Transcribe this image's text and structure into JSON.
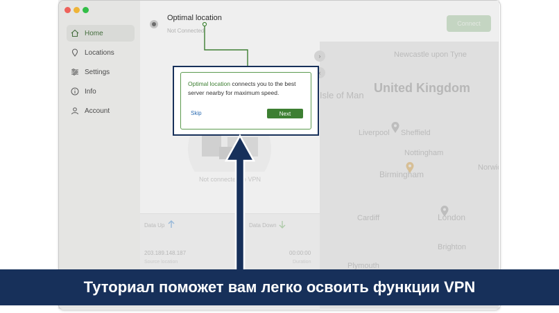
{
  "sidebar": {
    "items": [
      {
        "label": "Home",
        "icon": "home-icon",
        "active": true
      },
      {
        "label": "Locations",
        "icon": "map-pin-icon"
      },
      {
        "label": "Settings",
        "icon": "sliders-icon"
      },
      {
        "label": "Info",
        "icon": "info-icon"
      },
      {
        "label": "Account",
        "icon": "user-icon"
      }
    ]
  },
  "header": {
    "location_title": "Optimal location",
    "status_text": "Not Connected",
    "connect_label": "Connect"
  },
  "center": {
    "status_text": "Not connected to VPN"
  },
  "stats": {
    "data_up_label": "Data Up",
    "data_down_label": "Data Down",
    "ip_address": "203.189.148.187",
    "duration": "00:00:00",
    "ip_sublabel": "Source location",
    "duration_sublabel": "Duration"
  },
  "map": {
    "regions": [
      "United Kingdom"
    ],
    "cities": [
      "Newcastle upon Tyne",
      "Liverpool",
      "Sheffield",
      "Nottingham",
      "Birmingham",
      "London",
      "Cardiff",
      "Brighton",
      "Plymouth",
      "Norwich",
      "Isle of Man"
    ]
  },
  "tooltip": {
    "highlight": "Optimal location",
    "text": " connects you to the best server nearby for maximum speed.",
    "skip_label": "Skip",
    "next_label": "Next"
  },
  "caption": {
    "text": "Туториал поможет вам легко освоить функции VPN"
  },
  "colors": {
    "accent_green": "#3d7f32",
    "annotation_navy": "#17305a"
  }
}
